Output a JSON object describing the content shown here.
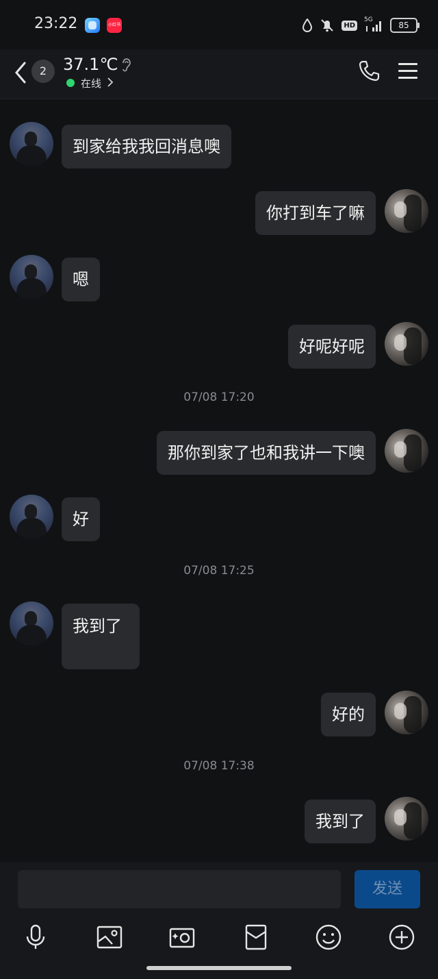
{
  "status_bar": {
    "time": "23:22",
    "app_icons": [
      "alipay-like-blue-icon",
      "xiaohongshu-icon"
    ],
    "xiaohongshu_label": "小红书",
    "hd_label": "HD",
    "network": "5G",
    "battery": "85"
  },
  "header": {
    "unread_count": "2",
    "contact_name": "37.1℃",
    "status": "在线"
  },
  "messages": [
    {
      "side": "left",
      "text": "到家给我我回消息噢"
    },
    {
      "side": "right",
      "text": "你打到车了嘛"
    },
    {
      "side": "left",
      "text": "嗯"
    },
    {
      "side": "right",
      "text": "好呢好呢"
    },
    {
      "type": "timestamp",
      "text": "07/08 17:20"
    },
    {
      "side": "right",
      "text": "那你到家了也和我讲一下噢"
    },
    {
      "side": "left",
      "text": "好"
    },
    {
      "type": "timestamp",
      "text": "07/08 17:25"
    },
    {
      "side": "left",
      "text": "我到了"
    },
    {
      "side": "right",
      "text": "好的"
    },
    {
      "type": "timestamp",
      "text": "07/08 17:38"
    },
    {
      "side": "right",
      "text": "我到了"
    }
  ],
  "composer": {
    "input_value": "",
    "send_label": "发送"
  },
  "toolbar": [
    "microphone-icon",
    "image-icon",
    "camera-icon",
    "red-envelope-icon",
    "emoji-icon",
    "plus-icon"
  ],
  "colors": {
    "background": "#111214",
    "bubble": "#2a2b2e",
    "online": "#2ed66f",
    "send_button": "#0b4a8a"
  }
}
